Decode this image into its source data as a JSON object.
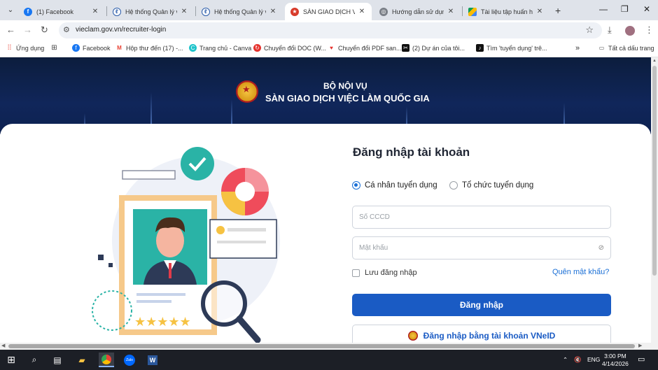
{
  "browser": {
    "tabs": [
      {
        "title": "(1) Facebook",
        "favicon": "facebook-icon",
        "active": false
      },
      {
        "title": "Hệ thống Quản lý văn",
        "favicon": "feather-icon",
        "active": false
      },
      {
        "title": "Hệ thống Quản lý văn",
        "favicon": "feather-icon",
        "active": false
      },
      {
        "title": "SÀN GIAO DỊCH VIỆC",
        "favicon": "emblem-icon",
        "active": true
      },
      {
        "title": "Hướng dẫn sử dụng",
        "favicon": "globe-icon",
        "active": false
      },
      {
        "title": "Tài liệu tập huấn hệ t",
        "favicon": "drive-icon",
        "active": false
      }
    ],
    "url": "vieclam.gov.vn/recruiter-login",
    "bookmarks": [
      {
        "label": "Ứng dụng",
        "icon": "apps-icon"
      },
      {
        "label": "Facebook",
        "icon": "facebook-icon"
      },
      {
        "label": "Hộp thư đến (17) -...",
        "icon": "gmail-icon"
      },
      {
        "label": "Trang chủ - Canva",
        "icon": "canva-icon"
      },
      {
        "label": "Chuyển đổi DOC (W...",
        "icon": "convert-icon"
      },
      {
        "label": "Chuyển đổi PDF san...",
        "icon": "heart-icon"
      },
      {
        "label": "(2) Dự án của tôi...",
        "icon": "capcut-icon"
      },
      {
        "label": "Tìm 'tuyển dụng' trê...",
        "icon": "tiktok-icon"
      }
    ],
    "all_bookmarks": "Tất cả dấu trang"
  },
  "header": {
    "ministry": "BỘ NỘI VỤ",
    "site_name": "SÀN GIAO DỊCH VIỆC LÀM QUỐC GIA"
  },
  "login": {
    "title": "Đăng nhập tài khoản",
    "radio_individual": "Cá nhân tuyển dụng",
    "radio_organization": "Tổ chức tuyển dụng",
    "selected": "individual",
    "cccd_placeholder": "Số CCCD",
    "password_placeholder": "Mật khẩu",
    "remember": "Lưu đăng nhập",
    "forgot": "Quên mật khẩu?",
    "login_button": "Đăng nhập",
    "vneid_button": "Đăng nhập bằng tài khoản VNeID"
  },
  "taskbar": {
    "lang": "ENG",
    "time": "3:00 PM",
    "date": "4/14/2026"
  },
  "colors": {
    "primary": "#1a5bc4",
    "hero_bg": "#0c1d3d",
    "link": "#1a6fd6"
  }
}
